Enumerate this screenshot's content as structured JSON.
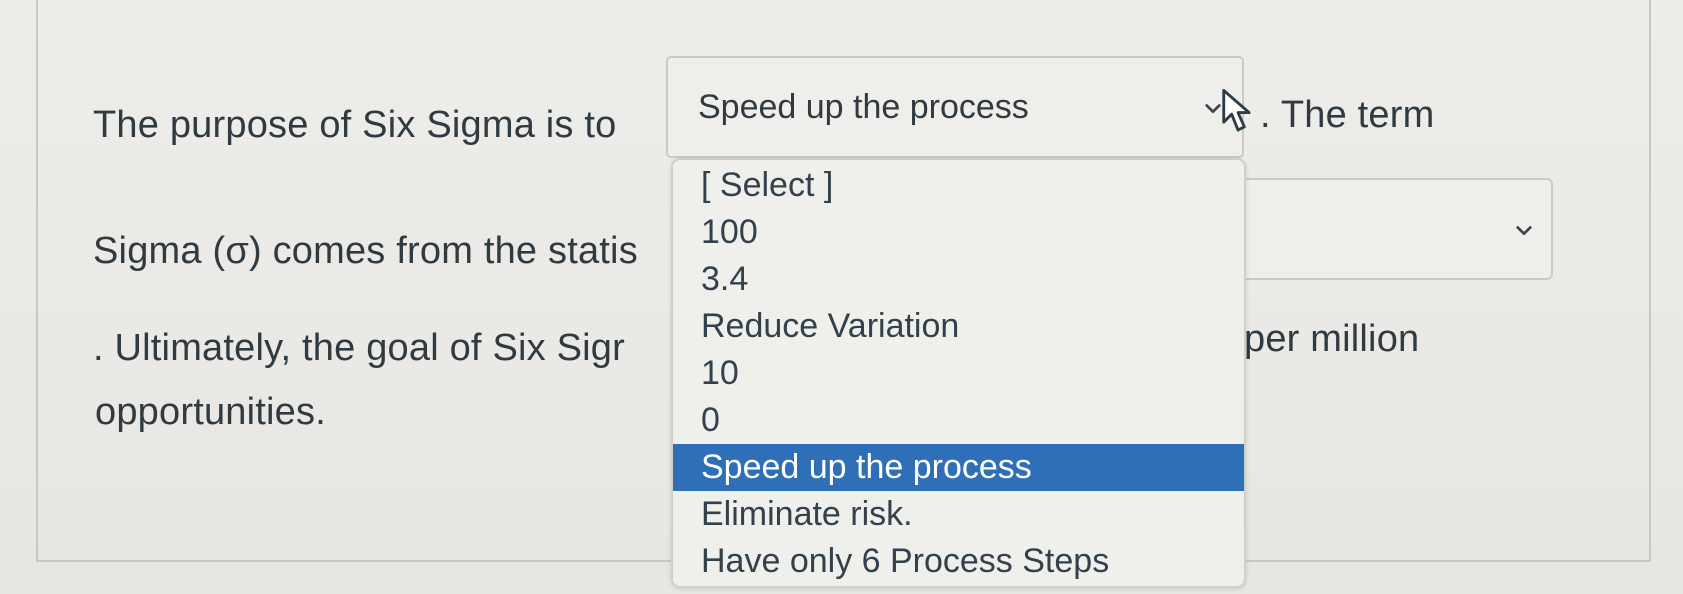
{
  "question": {
    "line1_prefix": "The purpose of Six Sigma is to",
    "line1_suffix": ". The term",
    "line2_prefix": "Sigma (σ) comes from the statis",
    "line3_prefix": ". Ultimately, the goal of Six Sigr",
    "line3_suffix": "per million",
    "line4": "opportunities."
  },
  "dropdown1": {
    "selected_value": "Speed up the process",
    "options": [
      "[ Select ]",
      "100",
      "3.4",
      "Reduce Variation",
      "10",
      "0",
      "Speed up the process",
      "Eliminate risk.",
      "Have only 6 Process Steps"
    ],
    "highlighted_index": 6
  },
  "dropdown2": {
    "selected_value": ""
  },
  "icons": {
    "dropdown1_arrow": "chevron-down-icon",
    "dropdown2_arrow": "chevron-down-icon",
    "mouse_pointer": "mouse-pointer-icon"
  },
  "colors": {
    "highlight": "#2f6fb8",
    "text": "#2f3a41",
    "background": "#ecebe8"
  }
}
